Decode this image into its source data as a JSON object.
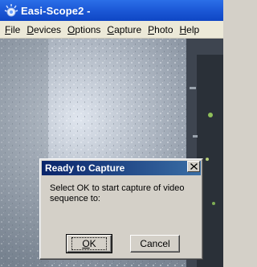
{
  "window": {
    "title": "Easi-Scope2 -",
    "icon": "scope-app-icon"
  },
  "menubar": {
    "items": [
      {
        "first": "F",
        "rest": "ile"
      },
      {
        "first": "D",
        "rest": "evices"
      },
      {
        "first": "O",
        "rest": "ptions"
      },
      {
        "first": "C",
        "rest": "apture"
      },
      {
        "first": "P",
        "rest": "hoto"
      },
      {
        "first": "H",
        "rest": "elp"
      }
    ]
  },
  "dialog": {
    "title": "Ready to Capture",
    "message": "Select OK to start capture of video sequence to:",
    "close_icon": "close-icon",
    "ok_first": "O",
    "ok_rest": "K",
    "cancel_label": "Cancel"
  },
  "colors": {
    "titlebar": "#1d5ad8",
    "dialog_title": "#0a246a",
    "face": "#d4d0c8"
  }
}
